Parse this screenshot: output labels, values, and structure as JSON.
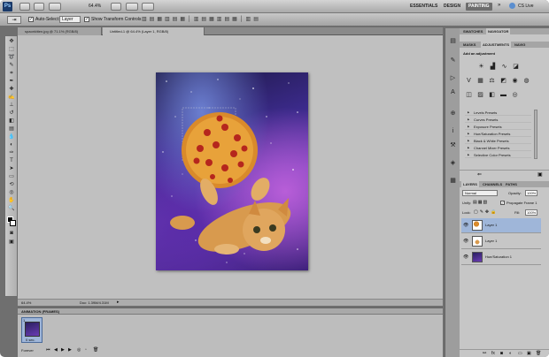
{
  "app": {
    "zoom": "64.4%",
    "workspaces": [
      "ESSENTIALS",
      "DESIGN",
      "PAINTING"
    ],
    "active_workspace": "PAINTING",
    "cs_live": "CS Live"
  },
  "options": {
    "auto_select_label": "Auto-Select:",
    "auto_select_value": "Layer",
    "show_transform_label": "Show Transform Controls"
  },
  "doc_tabs": [
    {
      "label": "spacekitten.jpg @ 71.1% (RGB/8)"
    },
    {
      "label": "Untitled-1 @ 64.4% (Layer 1, RGB/8)"
    }
  ],
  "status": {
    "zoom": "64.4%",
    "doc": "Doc: 1.39M/4.31M"
  },
  "adjustments": {
    "tabs": [
      "MASKS",
      "ADJUSTMENTS",
      "NAVIG"
    ],
    "top_tabs": [
      "SWATCHES",
      "NAVIGATOR"
    ],
    "heading": "Add an adjustment",
    "presets": [
      "Levels Presets",
      "Curves Presets",
      "Exposure Presets",
      "Hue/Saturation Presets",
      "Black & White Presets",
      "Channel Mixer Presets",
      "Selective Color Presets"
    ]
  },
  "layers_panel": {
    "tabs": [
      "LAYERS",
      "CHANNELS",
      "PATHS"
    ],
    "blend_mode": "Normal",
    "opacity_label": "Opacity:",
    "opacity": "100%",
    "unify_label": "Unify:",
    "propagate_label": "Propagate Frame 1",
    "lock_label": "Lock:",
    "fill_label": "Fill:",
    "fill": "100%",
    "layers": [
      {
        "name": "Layer 1"
      },
      {
        "name": "Layer 1"
      },
      {
        "name": "Hue/Saturation 1"
      }
    ]
  },
  "animation": {
    "title": "ANIMATION (FRAMES)",
    "frame_number": "1",
    "frame_delay": "0 sec.",
    "loop": "Forever"
  },
  "colors": {
    "selected_layer": "#9fb6d9",
    "panel_bg": "#c6c6c6",
    "canvas_bg": "#c0c0c0"
  }
}
